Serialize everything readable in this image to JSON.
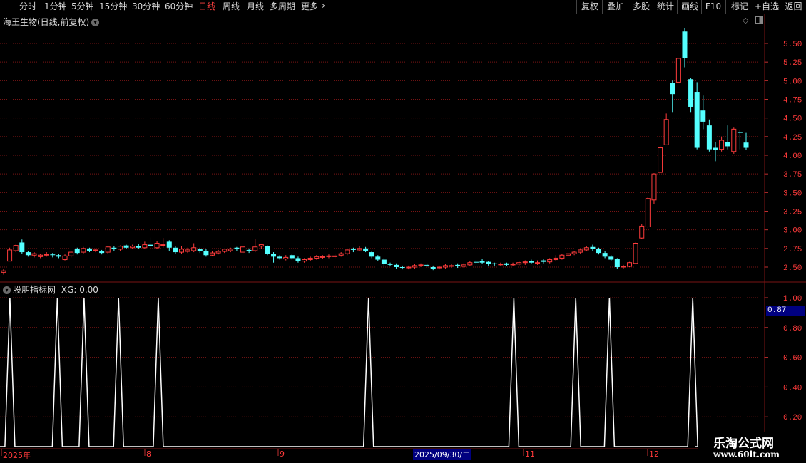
{
  "toolbar": {
    "periods": [
      {
        "label": "分时",
        "active": false
      },
      {
        "label": "1分钟",
        "active": false
      },
      {
        "label": "5分钟",
        "active": false
      },
      {
        "label": "15分钟",
        "active": false
      },
      {
        "label": "30分钟",
        "active": false
      },
      {
        "label": "60分钟",
        "active": false
      },
      {
        "label": "日线",
        "active": true
      },
      {
        "label": "周线",
        "active": false
      },
      {
        "label": "月线",
        "active": false
      },
      {
        "label": "多周期",
        "active": false
      },
      {
        "label": "更多",
        "active": false
      }
    ],
    "more_icon": "chevron-right-icon",
    "buttons": [
      "复权",
      "叠加",
      "多股",
      "统计",
      "画线",
      "F10",
      "标记",
      "+自选",
      "返回"
    ]
  },
  "main_chart": {
    "title": "海王生物(日线,前复权)",
    "title_icon": "chevron-down-icon",
    "y_ticks": [
      "5.50",
      "5.25",
      "5.00",
      "4.75",
      "4.50",
      "4.25",
      "4.00",
      "3.75",
      "3.50",
      "3.25",
      "3.00",
      "2.75",
      "2.50"
    ]
  },
  "indicator": {
    "title": "股朋指标网",
    "title_icon": "chevron-down-icon",
    "xg_text": "XG: 0.00",
    "y_ticks": [
      "1.00",
      "0.80",
      "0.60",
      "0.40",
      "0.20"
    ],
    "cursor_value": "0.87"
  },
  "date_axis": {
    "labels": [
      "2025年",
      "8",
      "9",
      "11",
      "12"
    ],
    "highlight": "2025/09/30/二"
  },
  "watermark": {
    "line1": "乐淘公式网",
    "line2": "www.60lt.com"
  },
  "colors": {
    "up": "#ff3c3c",
    "down": "#54ffff",
    "grid": "#7a1414",
    "line": "#ffffff"
  },
  "chart_data": {
    "type": "candlestick",
    "y_range": [
      2.4,
      5.75
    ],
    "candles": [
      [
        2.43,
        2.45,
        2.4,
        2.48
      ],
      [
        2.58,
        2.73,
        2.58,
        2.76
      ],
      [
        2.72,
        2.79,
        2.7,
        2.8
      ],
      [
        2.83,
        2.7,
        2.68,
        2.87
      ],
      [
        2.7,
        2.66,
        2.64,
        2.72
      ],
      [
        2.66,
        2.68,
        2.63,
        2.7
      ],
      [
        2.64,
        2.66,
        2.62,
        2.68
      ],
      [
        2.66,
        2.67,
        2.64,
        2.7
      ],
      [
        2.67,
        2.66,
        2.63,
        2.69
      ],
      [
        2.66,
        2.64,
        2.62,
        2.68
      ],
      [
        2.6,
        2.65,
        2.59,
        2.67
      ],
      [
        2.65,
        2.7,
        2.63,
        2.72
      ],
      [
        2.74,
        2.69,
        2.67,
        2.76
      ],
      [
        2.7,
        2.75,
        2.68,
        2.77
      ],
      [
        2.75,
        2.72,
        2.7,
        2.76
      ],
      [
        2.72,
        2.73,
        2.7,
        2.75
      ],
      [
        2.71,
        2.69,
        2.67,
        2.73
      ],
      [
        2.7,
        2.77,
        2.68,
        2.78
      ],
      [
        2.76,
        2.74,
        2.72,
        2.78
      ],
      [
        2.74,
        2.78,
        2.72,
        2.79
      ],
      [
        2.79,
        2.76,
        2.74,
        2.8
      ],
      [
        2.76,
        2.78,
        2.74,
        2.8
      ],
      [
        2.78,
        2.76,
        2.74,
        2.81
      ],
      [
        2.76,
        2.8,
        2.74,
        2.84
      ],
      [
        2.8,
        2.78,
        2.76,
        2.9
      ],
      [
        2.76,
        2.82,
        2.74,
        2.85
      ],
      [
        2.8,
        2.8,
        2.76,
        2.89
      ],
      [
        2.84,
        2.76,
        2.72,
        2.86
      ],
      [
        2.76,
        2.7,
        2.68,
        2.78
      ],
      [
        2.7,
        2.74,
        2.68,
        2.78
      ],
      [
        2.71,
        2.73,
        2.69,
        2.76
      ],
      [
        2.72,
        2.76,
        2.7,
        2.82
      ],
      [
        2.74,
        2.71,
        2.69,
        2.76
      ],
      [
        2.72,
        2.66,
        2.64,
        2.74
      ],
      [
        2.66,
        2.69,
        2.65,
        2.71
      ],
      [
        2.69,
        2.71,
        2.67,
        2.73
      ],
      [
        2.71,
        2.74,
        2.69,
        2.75
      ],
      [
        2.72,
        2.74,
        2.7,
        2.76
      ],
      [
        2.76,
        2.74,
        2.72,
        2.77
      ],
      [
        2.7,
        2.77,
        2.68,
        2.78
      ],
      [
        2.73,
        2.72,
        2.69,
        2.75
      ],
      [
        2.72,
        2.77,
        2.7,
        2.88
      ],
      [
        2.78,
        2.8,
        2.74,
        2.81
      ],
      [
        2.78,
        2.68,
        2.66,
        2.79
      ],
      [
        2.68,
        2.64,
        2.56,
        2.7
      ],
      [
        2.64,
        2.62,
        2.6,
        2.66
      ],
      [
        2.61,
        2.63,
        2.59,
        2.66
      ],
      [
        2.66,
        2.62,
        2.6,
        2.68
      ],
      [
        2.62,
        2.58,
        2.56,
        2.64
      ],
      [
        2.58,
        2.6,
        2.56,
        2.62
      ],
      [
        2.6,
        2.62,
        2.58,
        2.64
      ],
      [
        2.62,
        2.64,
        2.6,
        2.66
      ],
      [
        2.63,
        2.64,
        2.61,
        2.66
      ],
      [
        2.64,
        2.65,
        2.62,
        2.67
      ],
      [
        2.64,
        2.65,
        2.62,
        2.68
      ],
      [
        2.66,
        2.68,
        2.64,
        2.7
      ],
      [
        2.68,
        2.73,
        2.66,
        2.75
      ],
      [
        2.74,
        2.73,
        2.7,
        2.76
      ],
      [
        2.73,
        2.75,
        2.71,
        2.78
      ],
      [
        2.75,
        2.72,
        2.7,
        2.77
      ],
      [
        2.7,
        2.64,
        2.62,
        2.72
      ],
      [
        2.64,
        2.6,
        2.58,
        2.66
      ],
      [
        2.6,
        2.54,
        2.52,
        2.62
      ],
      [
        2.54,
        2.53,
        2.51,
        2.56
      ],
      [
        2.53,
        2.5,
        2.48,
        2.55
      ],
      [
        2.5,
        2.49,
        2.47,
        2.52
      ],
      [
        2.49,
        2.5,
        2.47,
        2.52
      ],
      [
        2.5,
        2.52,
        2.48,
        2.54
      ],
      [
        2.52,
        2.53,
        2.5,
        2.55
      ],
      [
        2.53,
        2.52,
        2.5,
        2.55
      ],
      [
        2.5,
        2.48,
        2.46,
        2.52
      ],
      [
        2.49,
        2.5,
        2.47,
        2.52
      ],
      [
        2.5,
        2.52,
        2.48,
        2.54
      ],
      [
        2.51,
        2.52,
        2.49,
        2.54
      ],
      [
        2.53,
        2.51,
        2.49,
        2.55
      ],
      [
        2.51,
        2.53,
        2.49,
        2.55
      ],
      [
        2.53,
        2.56,
        2.51,
        2.58
      ],
      [
        2.57,
        2.56,
        2.54,
        2.59
      ],
      [
        2.58,
        2.56,
        2.54,
        2.61
      ],
      [
        2.57,
        2.54,
        2.52,
        2.58
      ],
      [
        2.55,
        2.54,
        2.52,
        2.56
      ],
      [
        2.54,
        2.54,
        2.52,
        2.56
      ],
      [
        2.55,
        2.53,
        2.51,
        2.56
      ],
      [
        2.53,
        2.54,
        2.51,
        2.56
      ],
      [
        2.54,
        2.56,
        2.52,
        2.58
      ],
      [
        2.56,
        2.57,
        2.53,
        2.59
      ],
      [
        2.58,
        2.56,
        2.54,
        2.6
      ],
      [
        2.55,
        2.56,
        2.53,
        2.59
      ],
      [
        2.59,
        2.57,
        2.55,
        2.61
      ],
      [
        2.57,
        2.6,
        2.55,
        2.62
      ],
      [
        2.6,
        2.62,
        2.58,
        2.66
      ],
      [
        2.62,
        2.66,
        2.6,
        2.68
      ],
      [
        2.66,
        2.68,
        2.64,
        2.7
      ],
      [
        2.68,
        2.7,
        2.66,
        2.72
      ],
      [
        2.7,
        2.73,
        2.68,
        2.75
      ],
      [
        2.73,
        2.76,
        2.71,
        2.78
      ],
      [
        2.77,
        2.74,
        2.72,
        2.8
      ],
      [
        2.74,
        2.69,
        2.67,
        2.76
      ],
      [
        2.69,
        2.64,
        2.62,
        2.71
      ],
      [
        2.64,
        2.6,
        2.58,
        2.66
      ],
      [
        2.61,
        2.5,
        2.48,
        2.62
      ],
      [
        2.5,
        2.51,
        2.48,
        2.53
      ],
      [
        2.51,
        2.56,
        2.5,
        2.57
      ],
      [
        2.55,
        2.82,
        2.55,
        2.83
      ],
      [
        2.89,
        3.05,
        2.88,
        3.08
      ],
      [
        3.04,
        3.42,
        3.03,
        3.44
      ],
      [
        3.4,
        3.75,
        3.35,
        3.76
      ],
      [
        3.77,
        4.1,
        3.76,
        4.14
      ],
      [
        4.14,
        4.48,
        4.14,
        4.56
      ],
      [
        4.97,
        4.82,
        4.58,
        5.0
      ],
      [
        4.98,
        5.3,
        4.98,
        5.3
      ],
      [
        5.66,
        5.3,
        5.18,
        5.71
      ],
      [
        5.02,
        4.65,
        4.58,
        5.04
      ],
      [
        4.85,
        4.1,
        4.08,
        4.98
      ],
      [
        4.6,
        4.45,
        4.35,
        4.8
      ],
      [
        4.4,
        4.08,
        4.05,
        4.48
      ],
      [
        4.1,
        4.07,
        3.92,
        4.18
      ],
      [
        4.08,
        4.2,
        4.05,
        4.25
      ],
      [
        4.18,
        4.12,
        4.08,
        4.4
      ],
      [
        4.05,
        4.35,
        4.02,
        4.38
      ],
      [
        4.31,
        4.3,
        4.08,
        4.34
      ],
      [
        4.17,
        4.1,
        4.07,
        4.3
      ]
    ],
    "signal": [
      {
        "x": 0.013,
        "y": 1
      },
      {
        "x": 0.075,
        "y": 1
      },
      {
        "x": 0.11,
        "y": 1
      },
      {
        "x": 0.155,
        "y": 1
      },
      {
        "x": 0.207,
        "y": 1
      },
      {
        "x": 0.482,
        "y": 1
      },
      {
        "x": 0.672,
        "y": 1
      },
      {
        "x": 0.753,
        "y": 1
      },
      {
        "x": 0.797,
        "y": 1
      },
      {
        "x": 0.906,
        "y": 1
      }
    ],
    "signal_y_range": [
      0,
      1.0
    ]
  }
}
